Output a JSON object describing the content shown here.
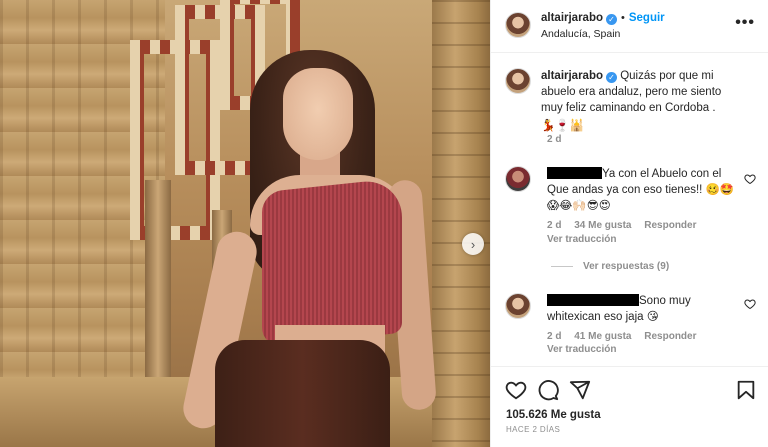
{
  "post": {
    "username": "altairjarabo",
    "verified_badge": "✓",
    "follow_label": "Seguir",
    "location": "Andalucía, Spain",
    "more_label": "•••",
    "next_label": "›"
  },
  "caption": {
    "username": "altairjarabo",
    "text": "Quizás por que mi abuelo era andaluz, pero me siento muy feliz caminando en Cordoba .",
    "emojis": "💃🍷🕌",
    "time": "2 d"
  },
  "comments": [
    {
      "text": "Ya con el Abuelo con el Que andas ya con eso tienes!! 🥴🤩",
      "emojis_line2": "😱😂🙌🏻😎😍",
      "time": "2 d",
      "likes": "34 Me gusta",
      "reply": "Responder",
      "translation": "Ver traducción"
    },
    {
      "text": "Sono muy whitexican eso jaja 😘",
      "time": "2 d",
      "likes": "41 Me gusta",
      "reply": "Responder",
      "translation": "Ver traducción"
    }
  ],
  "view_replies": "Ver respuestas (9)",
  "likes_count": "105.626 Me gusta",
  "post_date": "HACE 2 DÍAS",
  "icons": [
    "heart-icon",
    "comment-icon",
    "share-icon",
    "bookmark-icon",
    "more-icon",
    "chevron-right-icon",
    "verified-icon"
  ],
  "colors": {
    "accent": "#0095f6",
    "verified": "#3897f0",
    "muted": "#8e8e8e"
  }
}
